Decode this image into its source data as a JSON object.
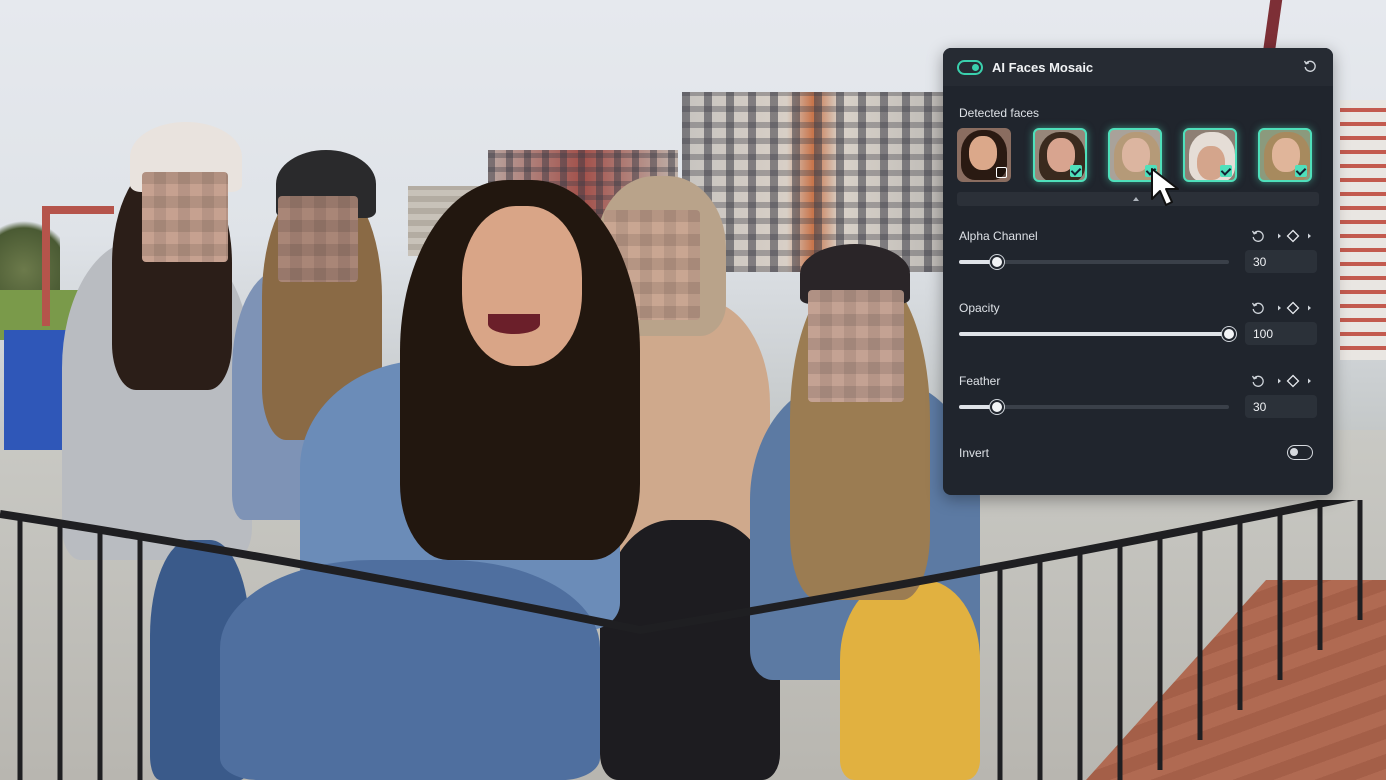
{
  "panel": {
    "title": "AI Faces Mosaic",
    "enabled": true,
    "detected_faces_label": "Detected faces",
    "faces": [
      {
        "name": "face-1",
        "selected": false
      },
      {
        "name": "face-2",
        "selected": true
      },
      {
        "name": "face-3",
        "selected": true
      },
      {
        "name": "face-4",
        "selected": true
      },
      {
        "name": "face-5",
        "selected": true
      }
    ],
    "controls": [
      {
        "label": "Alpha Channel",
        "value": "30",
        "level": 0.14
      },
      {
        "label": "Opacity",
        "value": "100",
        "level": 1.0
      },
      {
        "label": "Feather",
        "value": "30",
        "level": 0.14
      }
    ],
    "invert_label": "Invert",
    "invert_on": false
  },
  "colors": {
    "accent": "#4fe0bb",
    "panel_bg": "#20252d"
  }
}
